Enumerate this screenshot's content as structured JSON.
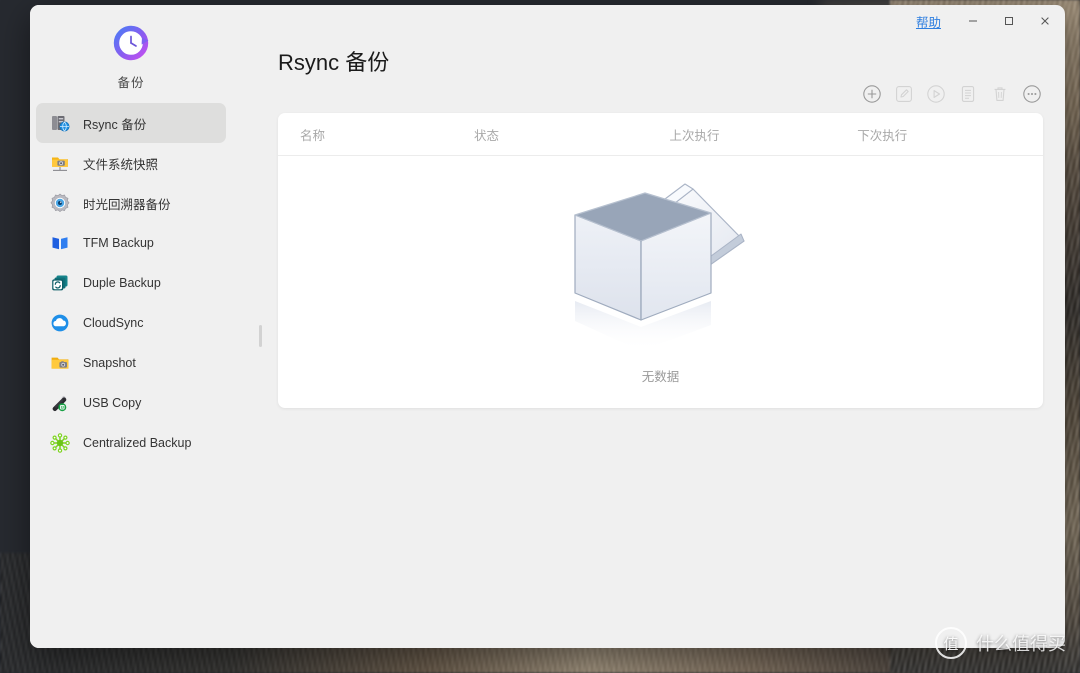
{
  "window": {
    "help_label": "帮助",
    "minimize_icon": "minimize-icon",
    "maximize_icon": "maximize-icon",
    "close_icon": "close-icon"
  },
  "sidebar": {
    "brand_label": "备份",
    "brand_icon": "clock-logo-icon",
    "items": [
      {
        "label": "Rsync 备份",
        "icon": "rsync-server-globe-icon",
        "selected": true
      },
      {
        "label": "文件系统快照",
        "icon": "folder-camera-icon",
        "selected": false
      },
      {
        "label": "时光回溯器备份",
        "icon": "gear-eye-icon",
        "selected": false
      },
      {
        "label": "TFM Backup",
        "icon": "blue-book-icon",
        "selected": false
      },
      {
        "label": "Duple Backup",
        "icon": "stacked-sync-icon",
        "selected": false
      },
      {
        "label": "CloudSync",
        "icon": "cloud-icon",
        "selected": false
      },
      {
        "label": "Snapshot",
        "icon": "folder-camera-icon",
        "selected": false
      },
      {
        "label": "USB Copy",
        "icon": "usb-drive-icon",
        "selected": false
      },
      {
        "label": "Centralized Backup",
        "icon": "network-nodes-icon",
        "selected": false
      }
    ]
  },
  "main": {
    "title": "Rsync 备份",
    "toolbar": [
      {
        "name": "add-button",
        "icon": "circle-plus-icon",
        "enabled": true
      },
      {
        "name": "edit-button",
        "icon": "pencil-square-icon",
        "enabled": false
      },
      {
        "name": "run-button",
        "icon": "circle-play-icon",
        "enabled": false
      },
      {
        "name": "log-button",
        "icon": "document-icon",
        "enabled": false
      },
      {
        "name": "delete-button",
        "icon": "trash-icon",
        "enabled": false
      },
      {
        "name": "more-button",
        "icon": "circle-ellipsis-icon",
        "enabled": true
      }
    ],
    "table": {
      "columns": [
        "名称",
        "状态",
        "上次执行",
        "下次执行"
      ],
      "rows": []
    },
    "empty_state": {
      "text": "无数据",
      "illustration": "open-empty-box-icon"
    }
  },
  "watermark": {
    "badge": "值",
    "text": "什么值得买"
  },
  "colors": {
    "accent_link": "#2f7fe0",
    "window_bg": "#f0f0f0",
    "card_bg": "#ffffff",
    "selected_item_bg": "#dededd",
    "muted_text": "#a8a8a8"
  }
}
